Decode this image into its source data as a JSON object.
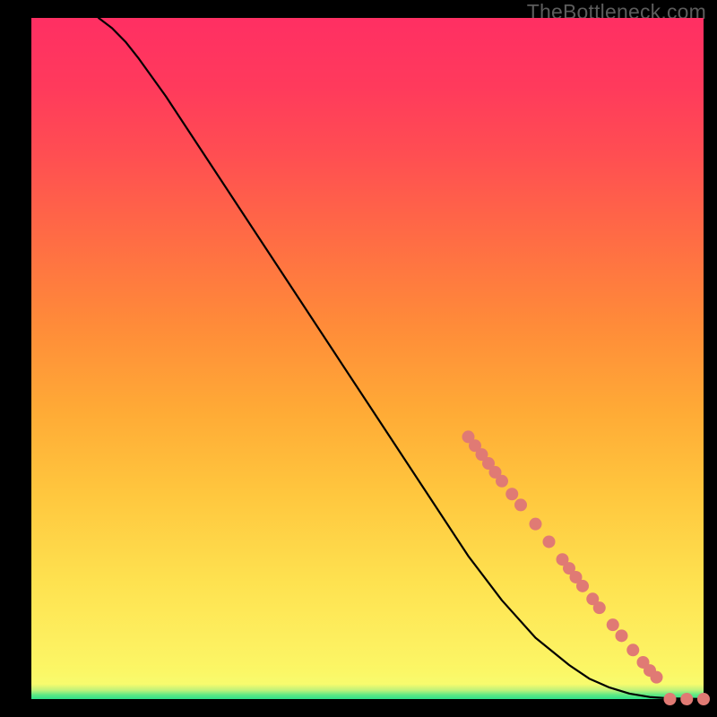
{
  "watermark": "TheBottleneck.com",
  "chart_data": {
    "type": "line",
    "title": "",
    "xlabel": "",
    "ylabel": "",
    "xlim": [
      0,
      100
    ],
    "ylim": [
      0,
      100
    ],
    "grid": false,
    "legend": false,
    "series": [
      {
        "name": "curve",
        "stroke": "#000000",
        "x": [
          10,
          12,
          14,
          16,
          20,
          25,
          30,
          35,
          40,
          45,
          50,
          55,
          60,
          65,
          70,
          75,
          80,
          83,
          86,
          89,
          92,
          95,
          98,
          100
        ],
        "y": [
          100,
          98.5,
          96.5,
          94,
          88.5,
          81,
          73.5,
          66,
          58.5,
          51,
          43.5,
          36,
          28.5,
          21,
          14.5,
          9,
          5,
          3,
          1.7,
          0.8,
          0.3,
          0.1,
          0.05,
          0.0
        ]
      }
    ],
    "markers": [
      {
        "name": "dotted-pink-segment",
        "color": "#e07a74",
        "radius_px": 7,
        "points": [
          {
            "x": 65.0,
            "y": 38.5
          },
          {
            "x": 66.0,
            "y": 37.2
          },
          {
            "x": 67.0,
            "y": 35.9
          },
          {
            "x": 68.0,
            "y": 34.6
          },
          {
            "x": 69.0,
            "y": 33.3
          },
          {
            "x": 70.0,
            "y": 32.0
          },
          {
            "x": 71.5,
            "y": 30.1
          },
          {
            "x": 72.8,
            "y": 28.5
          },
          {
            "x": 75.0,
            "y": 25.7
          },
          {
            "x": 77.0,
            "y": 23.1
          },
          {
            "x": 79.0,
            "y": 20.5
          },
          {
            "x": 80.0,
            "y": 19.2
          },
          {
            "x": 81.0,
            "y": 17.9
          },
          {
            "x": 82.0,
            "y": 16.6
          },
          {
            "x": 83.5,
            "y": 14.7
          },
          {
            "x": 84.5,
            "y": 13.4
          },
          {
            "x": 86.5,
            "y": 10.9
          },
          {
            "x": 87.8,
            "y": 9.3
          },
          {
            "x": 89.5,
            "y": 7.2
          },
          {
            "x": 91.0,
            "y": 5.4
          },
          {
            "x": 92.0,
            "y": 4.2
          },
          {
            "x": 93.0,
            "y": 3.2
          },
          {
            "x": 95.0,
            "y": 0.0
          },
          {
            "x": 97.5,
            "y": 0.0
          },
          {
            "x": 100.0,
            "y": 0.0
          }
        ]
      }
    ]
  }
}
